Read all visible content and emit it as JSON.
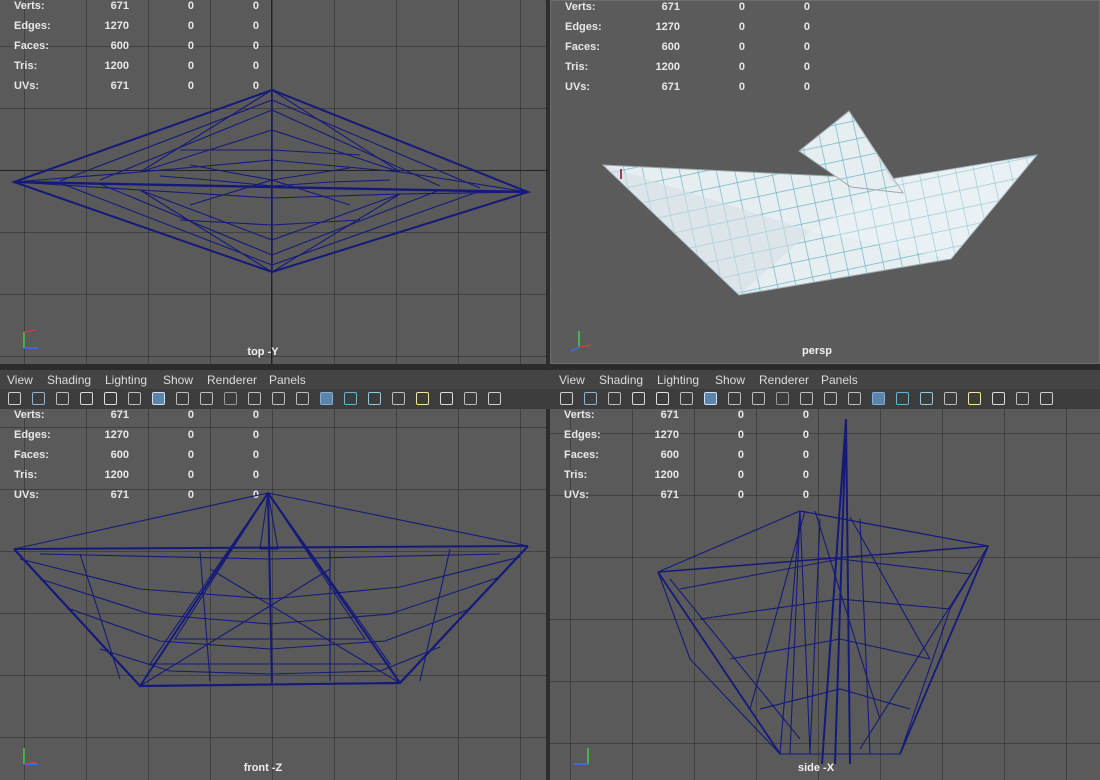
{
  "stats": {
    "labels": [
      "Verts:",
      "Edges:",
      "Faces:",
      "Tris:",
      "UVs:"
    ],
    "col0": [
      "671",
      "1270",
      "600",
      "1200",
      "671"
    ],
    "col1": [
      "0",
      "0",
      "0",
      "0",
      "0"
    ],
    "col2": [
      "0",
      "0",
      "0",
      "0",
      "0"
    ]
  },
  "viewports": {
    "top": {
      "name": "top -Y",
      "axes": [
        "y",
        "z"
      ]
    },
    "persp": {
      "name": "persp",
      "axes": [
        "y",
        "z",
        "x"
      ]
    },
    "front": {
      "name": "front -Z",
      "axes": [
        "y",
        "z"
      ]
    },
    "side": {
      "name": "side -X",
      "axes": [
        "y",
        "z"
      ]
    }
  },
  "menu": [
    "View",
    "Shading",
    "Lighting",
    "Show",
    "Renderer",
    "Panels"
  ],
  "colors": {
    "viewport_bg": "#5a5a5a",
    "wireframe": "#151a7a",
    "paper": "#e6eef1",
    "grid_ink": "#6fb8c4"
  },
  "toolbar_icons": [
    "select-icon",
    "lasso-icon",
    "paint-icon",
    "camera-icon",
    "bookmark-icon",
    "image-plane-icon",
    "grid-icon",
    "film-gate-icon",
    "resolution-gate-icon",
    "gate-mask-icon",
    "field-chart-icon",
    "safe-action-icon",
    "safe-title-icon",
    "wireframe-icon",
    "smooth-shade-icon",
    "wireframe-on-shaded-icon",
    "textured-icon",
    "lights-icon",
    "shadows-icon",
    "isolate-icon",
    "xray-icon"
  ]
}
